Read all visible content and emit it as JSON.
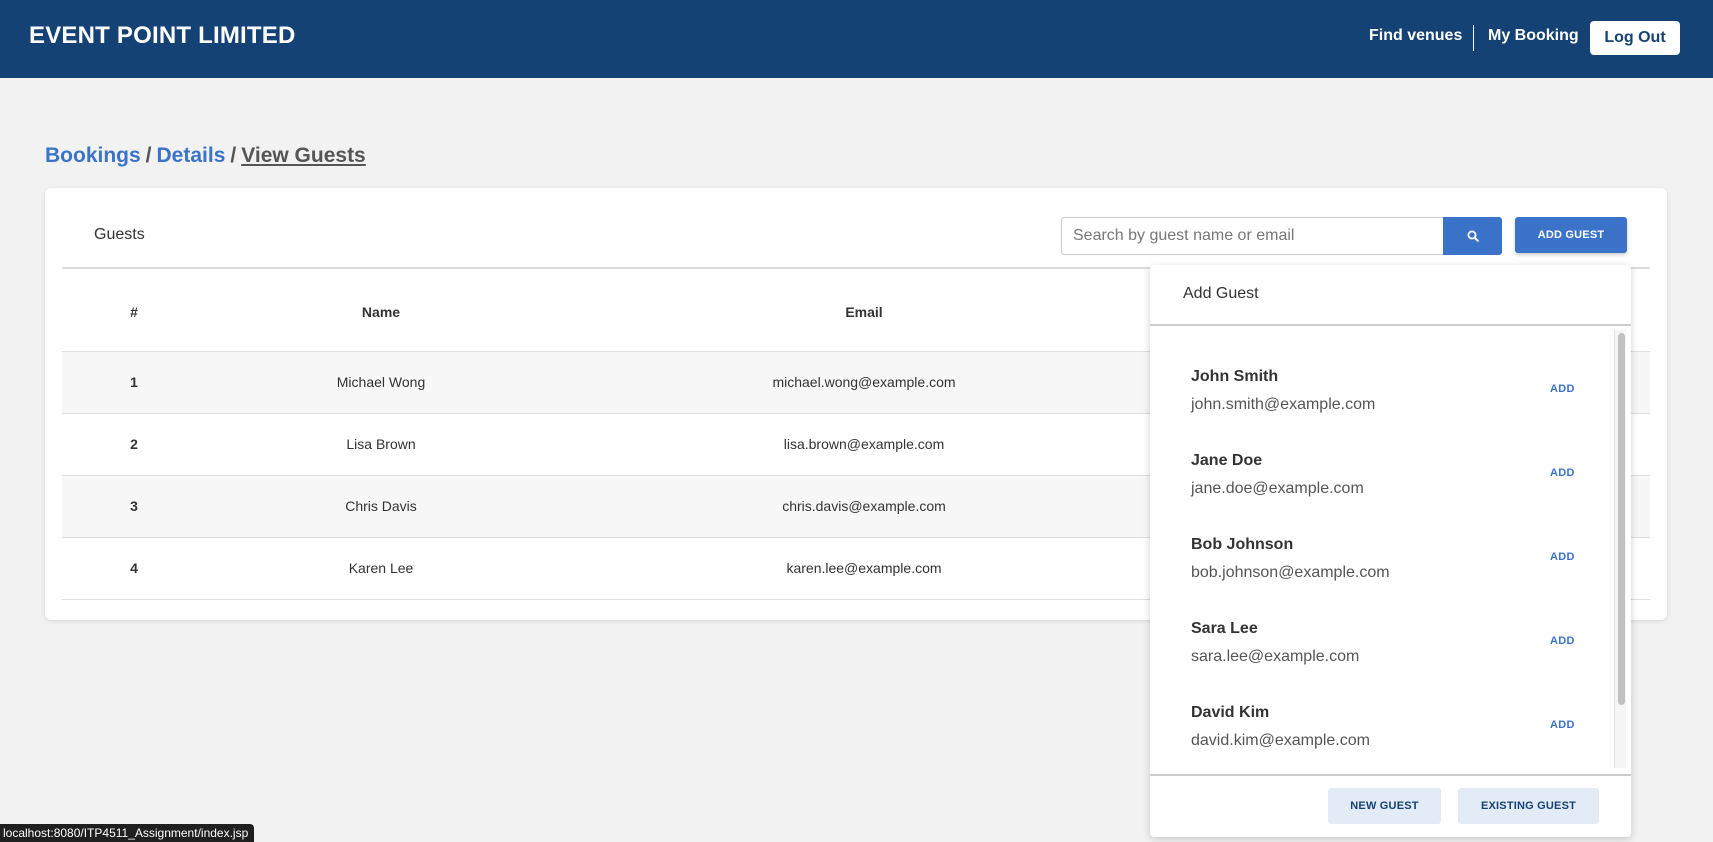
{
  "header": {
    "brand": "EVENT POINT LIMITED",
    "nav_find_venues": "Find venues",
    "nav_my_booking": "My Booking",
    "logout": "Log Out"
  },
  "breadcrumb": {
    "bookings": "Bookings",
    "separator": "/",
    "details": "Details",
    "current": "View Guests"
  },
  "guests_card": {
    "title": "Guests",
    "search_placeholder": "Search by guest name or email",
    "add_guest_label": "ADD GUEST",
    "columns": [
      "#",
      "Name",
      "Email"
    ],
    "rows": [
      {
        "num": "1",
        "name": "Michael Wong",
        "email": "michael.wong@example.com"
      },
      {
        "num": "2",
        "name": "Lisa Brown",
        "email": "lisa.brown@example.com"
      },
      {
        "num": "3",
        "name": "Chris Davis",
        "email": "chris.davis@example.com"
      },
      {
        "num": "4",
        "name": "Karen Lee",
        "email": "karen.lee@example.com"
      }
    ]
  },
  "add_guest_panel": {
    "title": "Add Guest",
    "add_label": "ADD",
    "guests": [
      {
        "name": "John Smith",
        "email": "john.smith@example.com"
      },
      {
        "name": "Jane Doe",
        "email": "jane.doe@example.com"
      },
      {
        "name": "Bob Johnson",
        "email": "bob.johnson@example.com"
      },
      {
        "name": "Sara Lee",
        "email": "sara.lee@example.com"
      },
      {
        "name": "David Kim",
        "email": "david.kim@example.com"
      }
    ],
    "new_guest_label": "NEW GUEST",
    "existing_guest_label": "EXISTING GUEST"
  },
  "status_bar": {
    "url": "localhost:8080/ITP4511_Assignment/index.jsp"
  },
  "colors": {
    "header_bg": "#154274",
    "accent": "#3b73c9",
    "page_bg": "#f2f2f2"
  }
}
